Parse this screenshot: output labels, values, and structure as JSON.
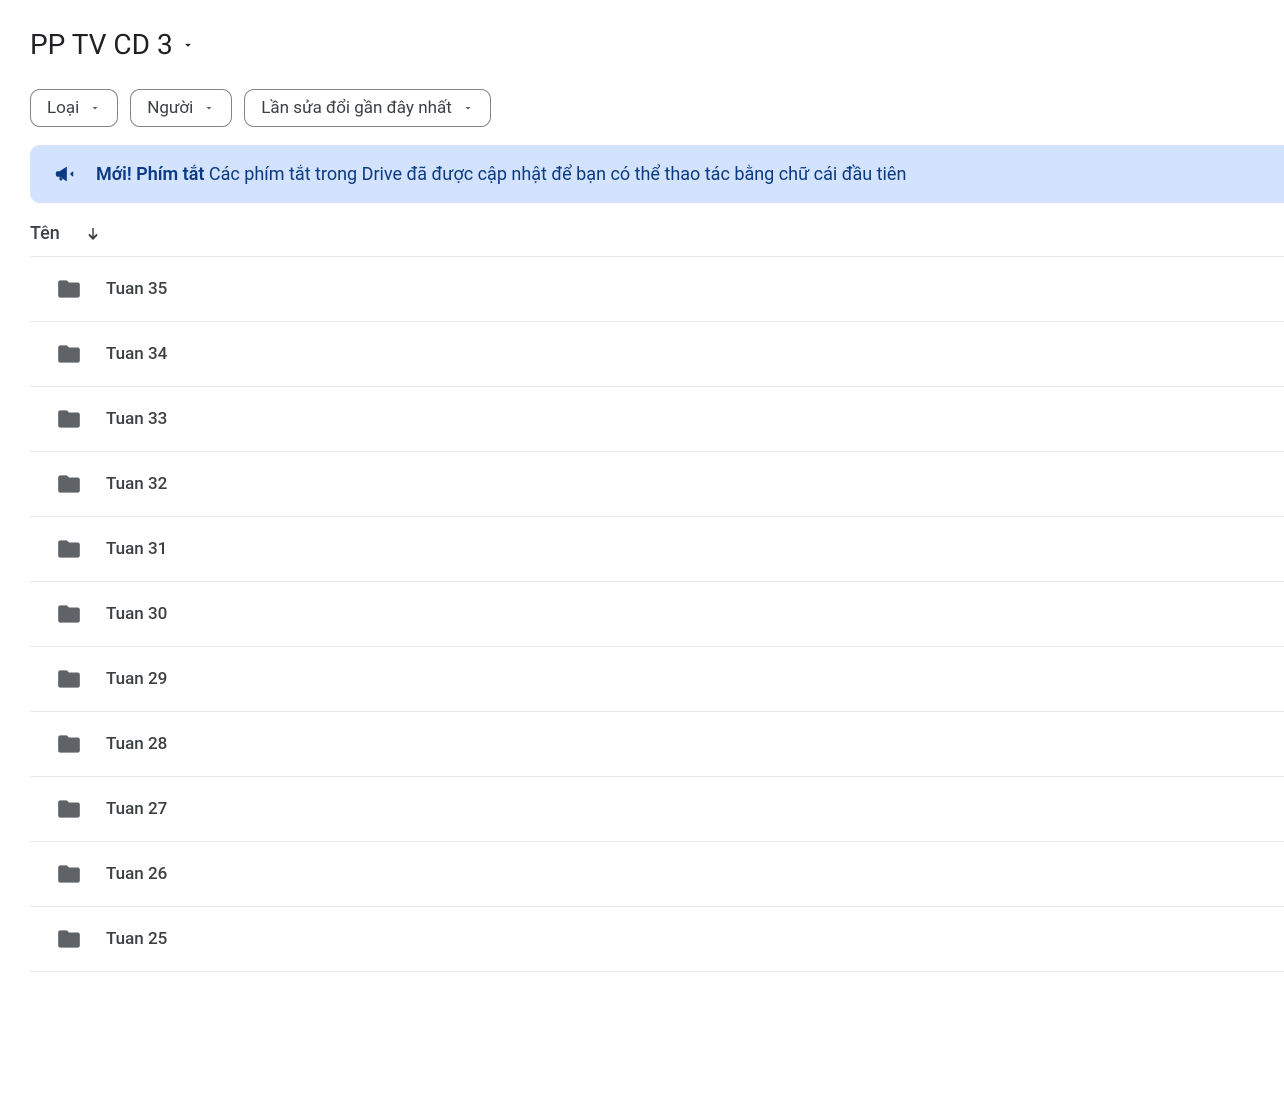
{
  "breadcrumb": {
    "title": "PP TV CD 3"
  },
  "filters": {
    "type_label": "Loại",
    "people_label": "Người",
    "modified_label": "Lần sửa đổi gần đây nhất"
  },
  "banner": {
    "bold_text": "Mới! Phím tắt",
    "text": " Các phím tắt trong Drive đã được cập nhật để bạn có thể thao tác bằng chữ cái đầu tiên"
  },
  "table": {
    "header_name": "Tên"
  },
  "folders": [
    {
      "name": "Tuan 35"
    },
    {
      "name": "Tuan 34"
    },
    {
      "name": "Tuan 33"
    },
    {
      "name": "Tuan 32"
    },
    {
      "name": "Tuan 31"
    },
    {
      "name": "Tuan 30"
    },
    {
      "name": "Tuan 29"
    },
    {
      "name": "Tuan 28"
    },
    {
      "name": "Tuan 27"
    },
    {
      "name": "Tuan 26"
    },
    {
      "name": "Tuan 25"
    }
  ]
}
